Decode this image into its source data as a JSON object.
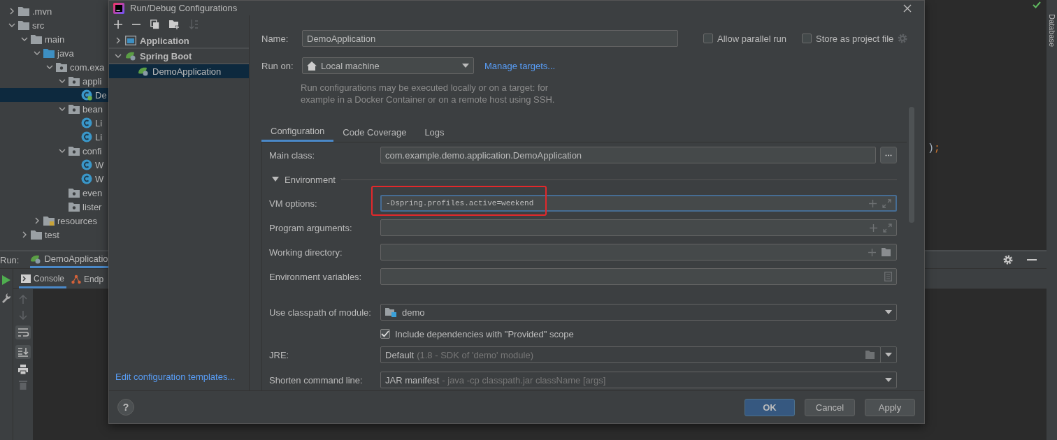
{
  "ide": {
    "project": [
      {
        "label": ".mvn",
        "kind": "folder",
        "expanded": false,
        "selected": false
      },
      {
        "label": "src",
        "kind": "folder",
        "expanded": true,
        "selected": false,
        "children": [
          {
            "label": "main",
            "kind": "folder",
            "expanded": true,
            "selected": false,
            "children": [
              {
                "label": "java",
                "kind": "source",
                "expanded": true,
                "selected": false,
                "children": [
                  {
                    "label": "com.exa",
                    "kind": "package",
                    "expanded": true,
                    "selected": false,
                    "children": [
                      {
                        "label": "appli",
                        "kind": "package",
                        "expanded": true,
                        "selected": false,
                        "children": [
                          {
                            "label": "De",
                            "kind": "boot-class",
                            "selected": true
                          }
                        ]
                      },
                      {
                        "label": "bean",
                        "kind": "package",
                        "expanded": true,
                        "selected": false,
                        "children": [
                          {
                            "label": "Li",
                            "kind": "class",
                            "selected": false
                          },
                          {
                            "label": "Li",
                            "kind": "class",
                            "selected": false
                          }
                        ]
                      },
                      {
                        "label": "confi",
                        "kind": "package",
                        "expanded": true,
                        "selected": false,
                        "children": [
                          {
                            "label": "W",
                            "kind": "class",
                            "selected": false
                          },
                          {
                            "label": "W",
                            "kind": "class",
                            "selected": false
                          }
                        ]
                      },
                      {
                        "label": "even",
                        "kind": "package",
                        "selected": false
                      },
                      {
                        "label": "lister",
                        "kind": "package",
                        "selected": false
                      }
                    ]
                  }
                ]
              },
              {
                "label": "resources",
                "kind": "resources",
                "expanded": false,
                "selected": false
              }
            ]
          },
          {
            "label": "test",
            "kind": "folder",
            "expanded": false,
            "selected": false
          }
        ]
      }
    ],
    "code": [
      {
        "text": ")",
        "kind": "plain"
      },
      {
        "text": ";",
        "kind": "keyword"
      }
    ],
    "side_strip": "Database",
    "run_panel": {
      "title": "Run:",
      "config_tab": "DemoApplicatio",
      "tabs": [
        {
          "label": "Console",
          "selected": true
        },
        {
          "label": "Endp",
          "selected": false
        }
      ]
    }
  },
  "dialog": {
    "title": "Run/Debug Configurations",
    "tree": [
      {
        "label": "Application",
        "kind": "application",
        "expanded": false,
        "selected": false
      },
      {
        "label": "Spring Boot",
        "kind": "spring-boot",
        "expanded": true,
        "selected": false,
        "children": [
          {
            "label": "DemoApplication",
            "kind": "spring-boot",
            "selected": true
          }
        ]
      }
    ],
    "templates_link": "Edit configuration templates...",
    "name": {
      "label": "Name:",
      "value": "DemoApplication"
    },
    "options": [
      {
        "label": "Allow parallel run",
        "checked": false
      },
      {
        "label": "Store as project file",
        "checked": false
      }
    ],
    "run_on": {
      "label": "Run on:",
      "value": "Local machine"
    },
    "manage_targets": "Manage targets...",
    "run_on_hint": "Run configurations may be executed locally or on a target: for example in a Docker Container or on a remote host using SSH.",
    "tabs": [
      {
        "label": "Configuration",
        "selected": true
      },
      {
        "label": "Code Coverage",
        "selected": false
      },
      {
        "label": "Logs",
        "selected": false
      }
    ],
    "rows": [
      {
        "kind": "class",
        "label": "Main class:",
        "value": "com.example.demo.application.DemoApplication"
      },
      {
        "kind": "section",
        "label": "Environment",
        "expanded": true
      },
      {
        "kind": "options",
        "label": "VM options:",
        "value": "-Dspring.profiles.active=weekend",
        "highlighted": true
      },
      {
        "kind": "options",
        "label": "Program arguments:",
        "highlighted": false
      },
      {
        "kind": "directory",
        "label": "Working directory:"
      },
      {
        "kind": "env",
        "label": "Environment variables:"
      },
      {
        "kind": "module",
        "label": "Use classpath of module:",
        "value": "demo"
      },
      {
        "kind": "checkbox",
        "label": "Include dependencies with \"Provided\" scope",
        "checked": true
      },
      {
        "kind": "jre",
        "label": "JRE:",
        "value": "Default",
        "detail": "(1.8 - SDK of 'demo' module)"
      },
      {
        "kind": "shorten",
        "label": "Shorten command line:",
        "value": "JAR manifest",
        "detail": "- java -cp classpath.jar className [args]"
      }
    ],
    "help": "?",
    "buttons": [
      {
        "label": "OK",
        "kind": "primary"
      },
      {
        "label": "Cancel",
        "kind": "normal"
      },
      {
        "label": "Apply",
        "kind": "normal"
      }
    ]
  }
}
